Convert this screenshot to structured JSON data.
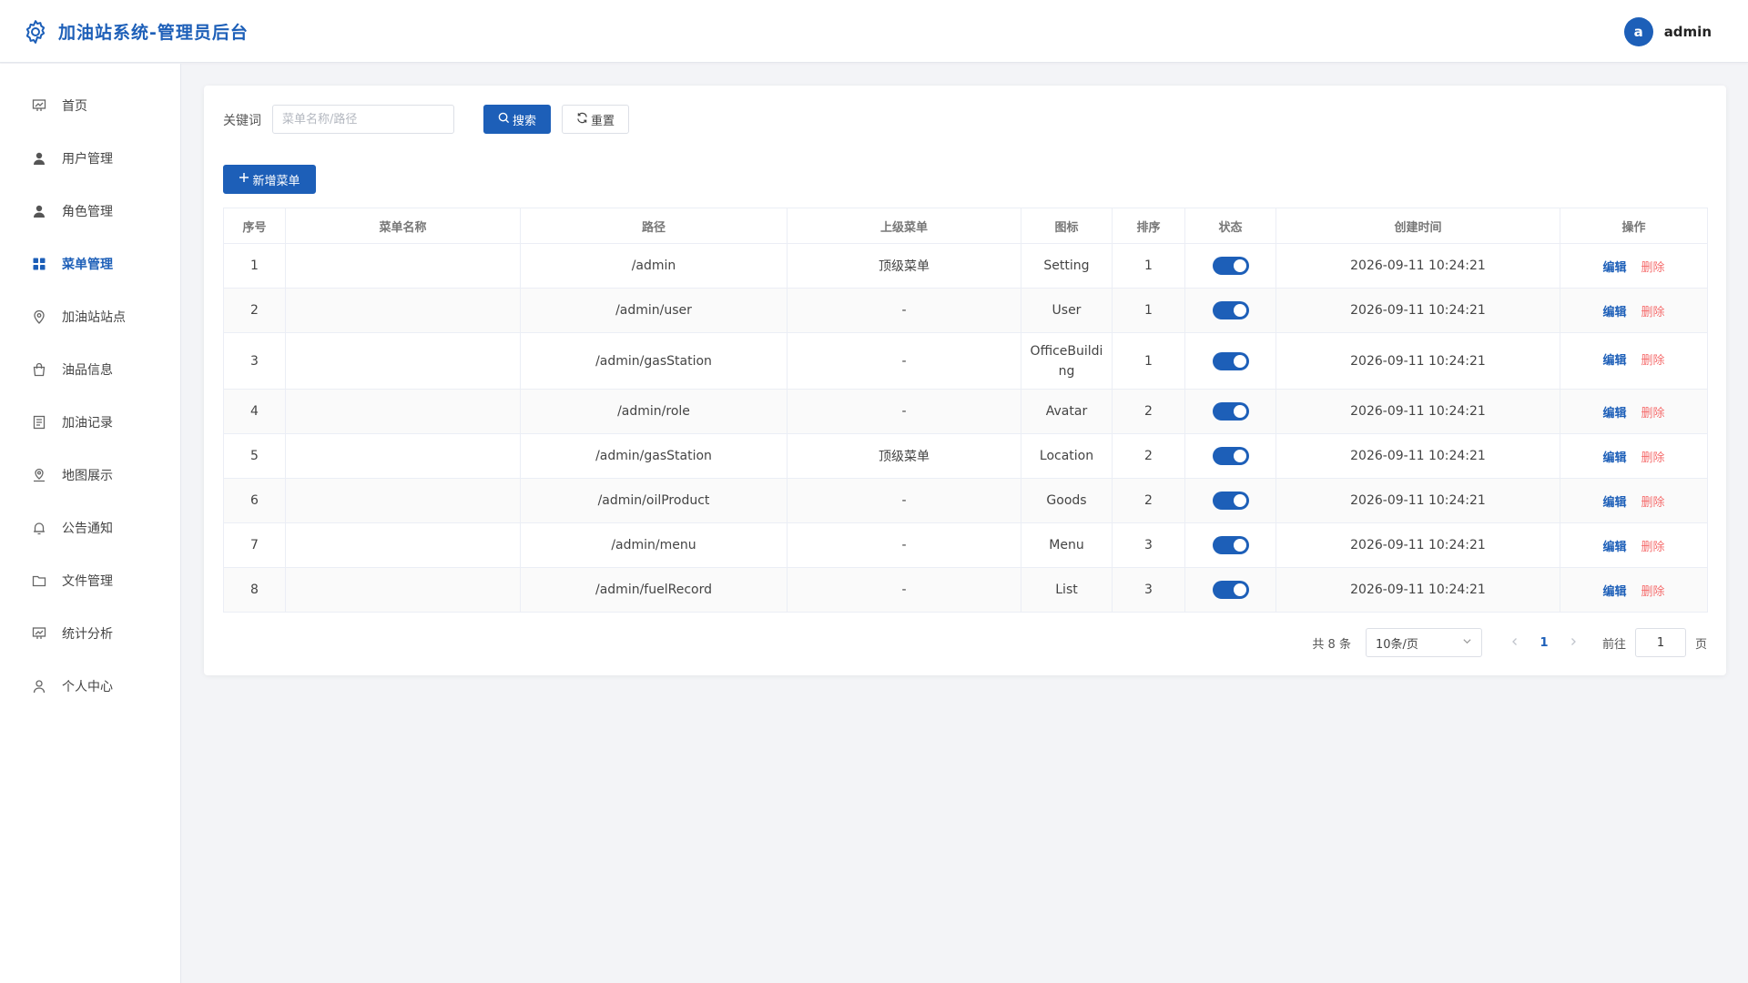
{
  "header": {
    "title": "加油站系统-管理员后台",
    "avatar_letter": "a",
    "username": "admin"
  },
  "sidebar": {
    "items": [
      {
        "label": "首页",
        "icon": "dashboard-icon"
      },
      {
        "label": "用户管理",
        "icon": "user-icon"
      },
      {
        "label": "角色管理",
        "icon": "avatar-icon"
      },
      {
        "label": "菜单管理",
        "icon": "menu-grid-icon",
        "active": true
      },
      {
        "label": "加油站站点",
        "icon": "location-icon"
      },
      {
        "label": "油品信息",
        "icon": "goods-bag-icon"
      },
      {
        "label": "加油记录",
        "icon": "list-icon"
      },
      {
        "label": "地图展示",
        "icon": "map-location-icon"
      },
      {
        "label": "公告通知",
        "icon": "bell-icon"
      },
      {
        "label": "文件管理",
        "icon": "folder-icon"
      },
      {
        "label": "统计分析",
        "icon": "chart-icon"
      },
      {
        "label": "个人中心",
        "icon": "user-outline-icon"
      }
    ]
  },
  "search": {
    "keyword_label": "关键词",
    "placeholder": "菜单名称/路径",
    "value": "",
    "search_label": "搜索",
    "reset_label": "重置",
    "add_label": "新增菜单"
  },
  "table": {
    "headers": [
      "序号",
      "菜单名称",
      "路径",
      "上级菜单",
      "图标",
      "排序",
      "状态",
      "创建时间",
      "操作"
    ],
    "edit_label": "编辑",
    "delete_label": "删除",
    "rows": [
      {
        "index": "1",
        "name": "",
        "path": "/admin",
        "parent": "顶级菜单",
        "icon": "Setting",
        "sort": "1",
        "enabled": true,
        "created": "2026-09-11 10:24:21"
      },
      {
        "index": "2",
        "name": "",
        "path": "/admin/user",
        "parent": "-",
        "icon": "User",
        "sort": "1",
        "enabled": true,
        "created": "2026-09-11 10:24:21"
      },
      {
        "index": "3",
        "name": "",
        "path": "/admin/gasStation",
        "parent": "-",
        "icon": "OfficeBuilding",
        "sort": "1",
        "enabled": true,
        "created": "2026-09-11 10:24:21"
      },
      {
        "index": "4",
        "name": "",
        "path": "/admin/role",
        "parent": "-",
        "icon": "Avatar",
        "sort": "2",
        "enabled": true,
        "created": "2026-09-11 10:24:21"
      },
      {
        "index": "5",
        "name": "",
        "path": "/admin/gasStation",
        "parent": "顶级菜单",
        "icon": "Location",
        "sort": "2",
        "enabled": true,
        "created": "2026-09-11 10:24:21"
      },
      {
        "index": "6",
        "name": "",
        "path": "/admin/oilProduct",
        "parent": "-",
        "icon": "Goods",
        "sort": "2",
        "enabled": true,
        "created": "2026-09-11 10:24:21"
      },
      {
        "index": "7",
        "name": "",
        "path": "/admin/menu",
        "parent": "-",
        "icon": "Menu",
        "sort": "3",
        "enabled": true,
        "created": "2026-09-11 10:24:21"
      },
      {
        "index": "8",
        "name": "",
        "path": "/admin/fuelRecord",
        "parent": "-",
        "icon": "List",
        "sort": "3",
        "enabled": true,
        "created": "2026-09-11 10:24:21"
      }
    ]
  },
  "pagination": {
    "total_text": "共 8 条",
    "page_size": "10条/页",
    "current_page": "1",
    "goto_label": "前往",
    "goto_value": "1",
    "page_suffix": "页"
  },
  "colors": {
    "primary": "#1d5fb8",
    "danger": "#f56c6c"
  }
}
